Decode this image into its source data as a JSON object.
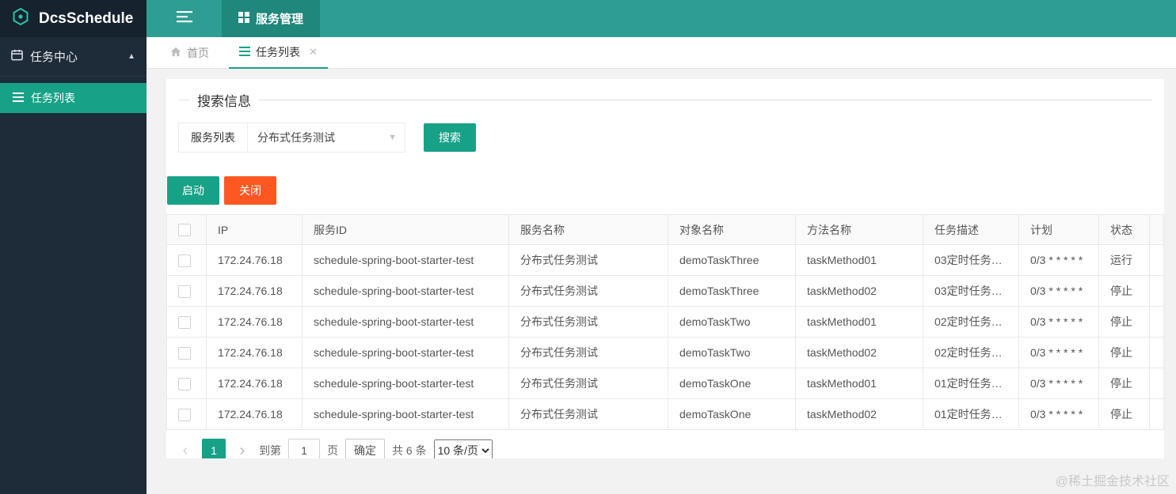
{
  "colors": {
    "header_teal": "#2e9e93",
    "header_active_tab_teal": "#1f877c",
    "accent_teal": "#17a288",
    "danger_orange": "#ff5722",
    "sidebar_navy": "#1e2b38",
    "logo_navy": "#16222e"
  },
  "header": {
    "brand": "DcsSchedule",
    "nav_tab": "服务管理"
  },
  "sidebar": {
    "group_label": "任务中心",
    "items": [
      {
        "label": "任务列表",
        "active": true
      }
    ]
  },
  "tabs_bar": {
    "home_label": "首页",
    "tabs": [
      {
        "label": "任务列表",
        "active": true
      }
    ]
  },
  "search_panel": {
    "legend": "搜索信息",
    "service_label": "服务列表",
    "service_selected": "分布式任务测试",
    "search_button": "搜索"
  },
  "actions": {
    "start_button": "启动",
    "close_button": "关闭"
  },
  "table": {
    "columns": [
      "IP",
      "服务ID",
      "服务名称",
      "对象名称",
      "方法名称",
      "任务描述",
      "计划",
      "状态"
    ],
    "rows": [
      {
        "ip": "172.24.76.18",
        "service_id": "schedule-spring-boot-starter-test",
        "service_name": "分布式任务测试",
        "object_name": "demoTaskThree",
        "method_name": "taskMethod01",
        "task_desc": "03定时任务…",
        "plan": "0/3 * * * * *",
        "status": "运行"
      },
      {
        "ip": "172.24.76.18",
        "service_id": "schedule-spring-boot-starter-test",
        "service_name": "分布式任务测试",
        "object_name": "demoTaskThree",
        "method_name": "taskMethod02",
        "task_desc": "03定时任务…",
        "plan": "0/3 * * * * *",
        "status": "停止"
      },
      {
        "ip": "172.24.76.18",
        "service_id": "schedule-spring-boot-starter-test",
        "service_name": "分布式任务测试",
        "object_name": "demoTaskTwo",
        "method_name": "taskMethod01",
        "task_desc": "02定时任务…",
        "plan": "0/3 * * * * *",
        "status": "停止"
      },
      {
        "ip": "172.24.76.18",
        "service_id": "schedule-spring-boot-starter-test",
        "service_name": "分布式任务测试",
        "object_name": "demoTaskTwo",
        "method_name": "taskMethod02",
        "task_desc": "02定时任务…",
        "plan": "0/3 * * * * *",
        "status": "停止"
      },
      {
        "ip": "172.24.76.18",
        "service_id": "schedule-spring-boot-starter-test",
        "service_name": "分布式任务测试",
        "object_name": "demoTaskOne",
        "method_name": "taskMethod01",
        "task_desc": "01定时任务…",
        "plan": "0/3 * * * * *",
        "status": "停止"
      },
      {
        "ip": "172.24.76.18",
        "service_id": "schedule-spring-boot-starter-test",
        "service_name": "分布式任务测试",
        "object_name": "demoTaskOne",
        "method_name": "taskMethod02",
        "task_desc": "01定时任务…",
        "plan": "0/3 * * * * *",
        "status": "停止"
      }
    ]
  },
  "pagination": {
    "current_page": "1",
    "goto_label": "到第",
    "goto_value": "1",
    "goto_suffix": "页",
    "confirm_button": "确定",
    "total_text": "共 6 条",
    "page_size_option": "10 条/页"
  },
  "watermark": "@稀土掘金技术社区"
}
